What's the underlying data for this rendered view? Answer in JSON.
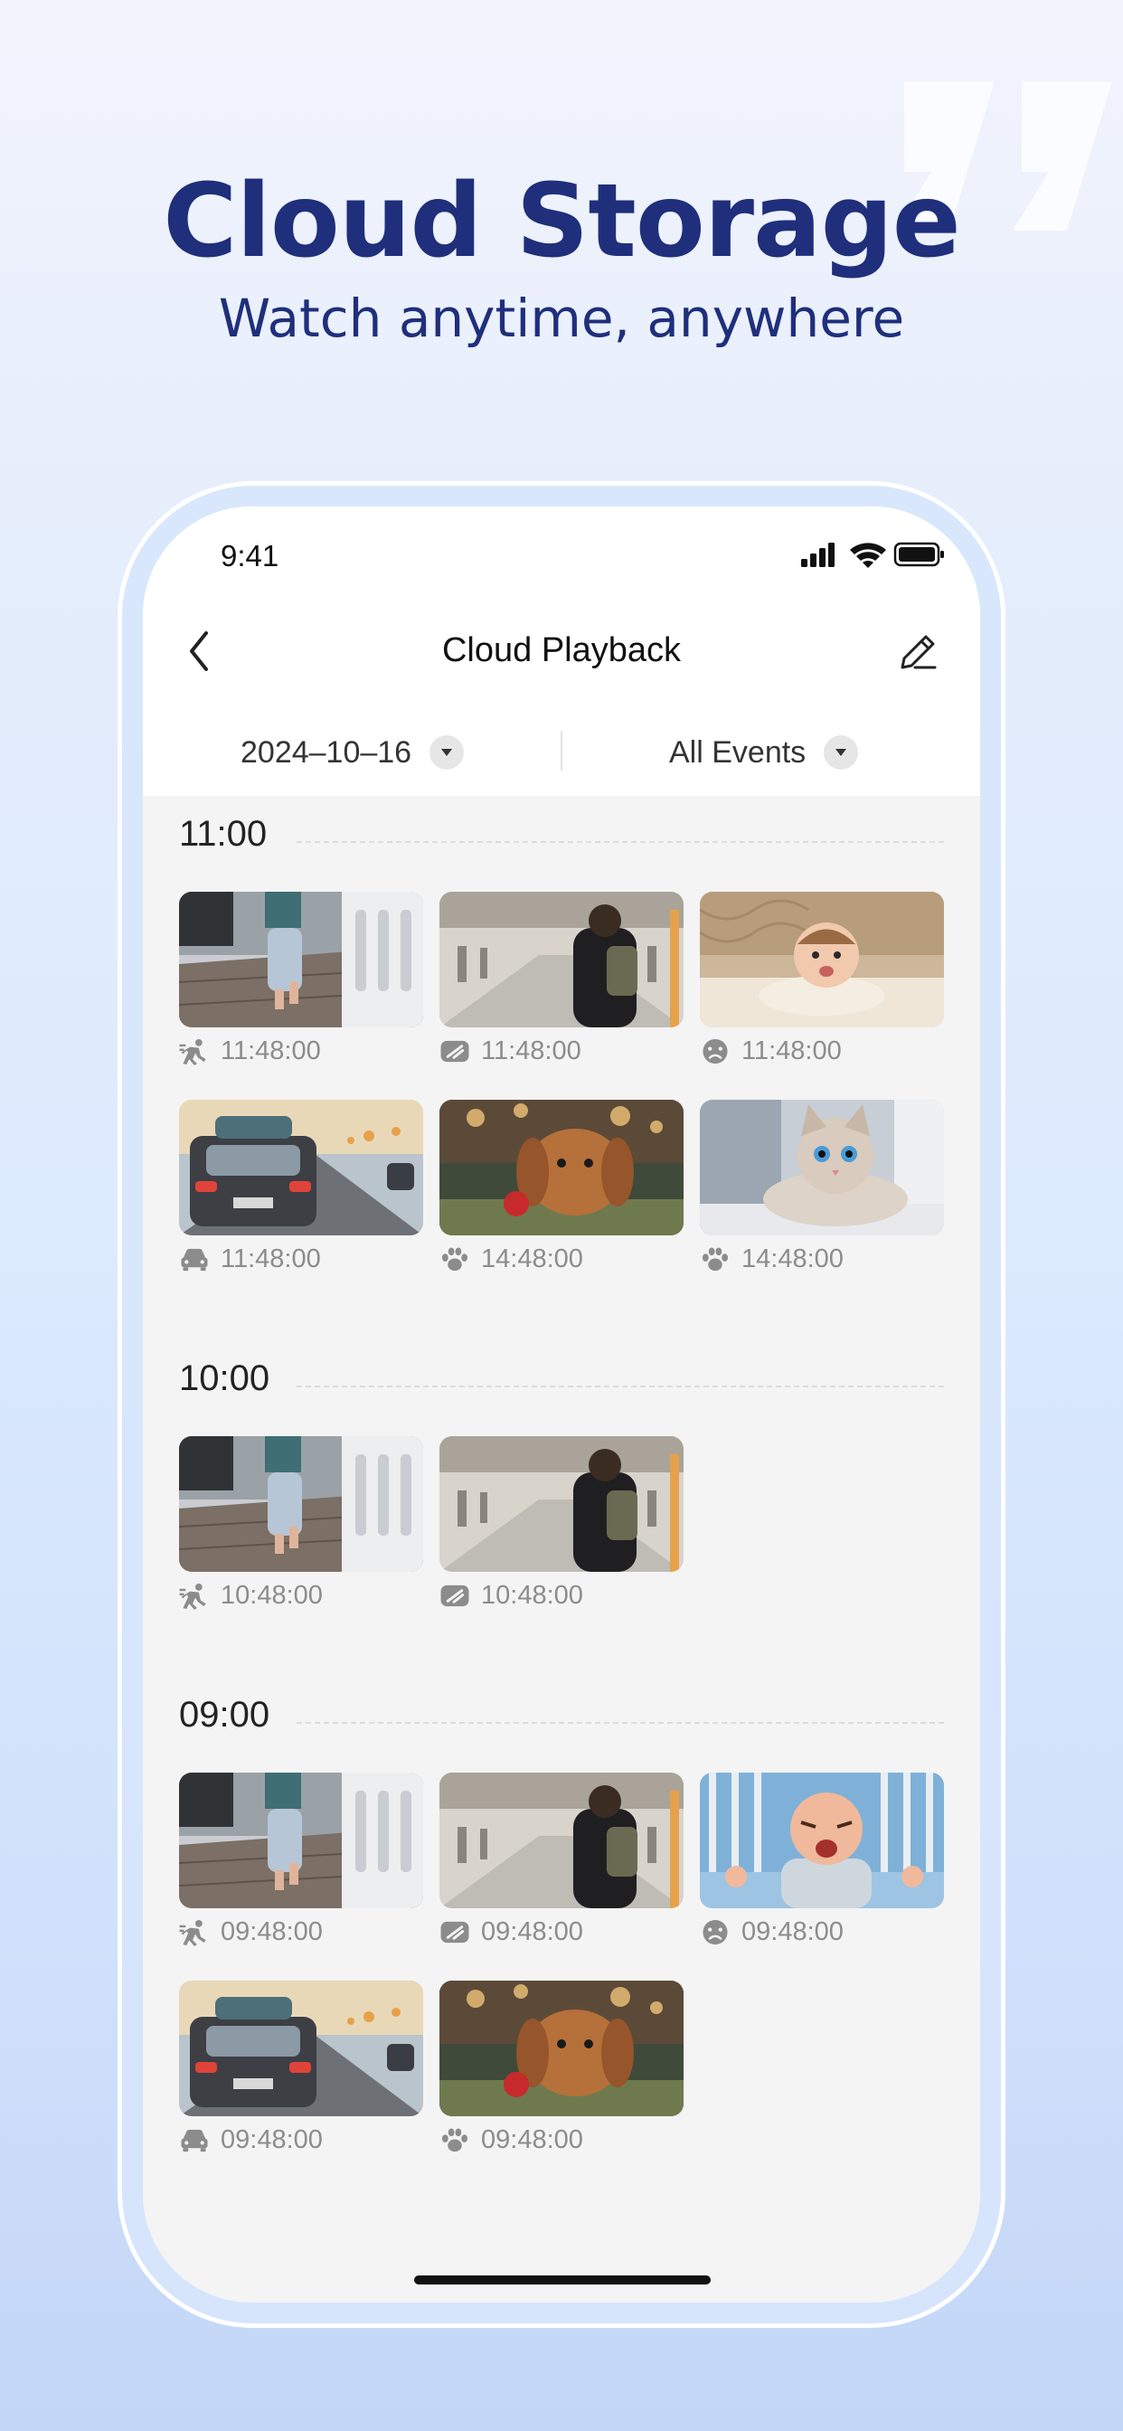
{
  "promo": {
    "headline": "Cloud Storage",
    "subline": "Watch anytime, anywhere"
  },
  "status_bar": {
    "time": "9:41"
  },
  "nav": {
    "title": "Cloud Playback"
  },
  "filters": {
    "date": "2024–10–16",
    "events": "All Events"
  },
  "sections": [
    {
      "title": "11:00",
      "clips": [
        {
          "scene": "toddler-walking",
          "event": "motion",
          "time": "11:48:00"
        },
        {
          "scene": "traveler-airport",
          "event": "person",
          "time": "11:48:00"
        },
        {
          "scene": "baby-on-rug",
          "event": "crying",
          "time": "11:48:00"
        },
        {
          "scene": "car-on-road",
          "event": "vehicle",
          "time": "11:48:00"
        },
        {
          "scene": "puppy-with-ball",
          "event": "pet",
          "time": "14:48:00"
        },
        {
          "scene": "cat-lying",
          "event": "pet",
          "time": "14:48:00"
        }
      ]
    },
    {
      "title": "10:00",
      "clips": [
        {
          "scene": "toddler-walking",
          "event": "motion",
          "time": "10:48:00"
        },
        {
          "scene": "traveler-airport",
          "event": "person",
          "time": "10:48:00"
        }
      ]
    },
    {
      "title": "09:00",
      "clips": [
        {
          "scene": "toddler-walking",
          "event": "motion",
          "time": "09:48:00"
        },
        {
          "scene": "traveler-airport",
          "event": "person",
          "time": "09:48:00"
        },
        {
          "scene": "crying-baby-crib",
          "event": "crying",
          "time": "09:48:00"
        },
        {
          "scene": "car-on-road",
          "event": "vehicle",
          "time": "09:48:00"
        },
        {
          "scene": "puppy-with-ball",
          "event": "pet",
          "time": "09:48:00"
        }
      ]
    }
  ],
  "colors": {
    "headline": "#1f2f7c",
    "screen_bg": "#f4f4f4",
    "meta_text": "#8c8c8c"
  }
}
